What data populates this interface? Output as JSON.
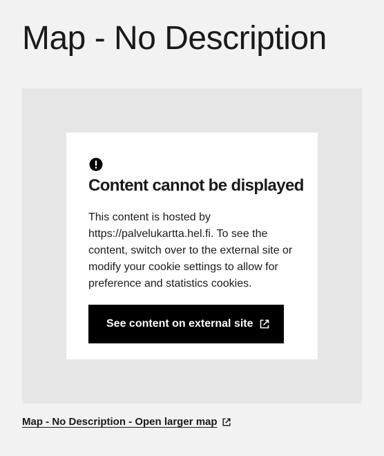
{
  "page": {
    "title": "Map - No Description"
  },
  "notice": {
    "icon": "alert-circle-icon",
    "heading": "Content cannot be displayed",
    "body": "This content is hosted by https://palvelukartta.hel.fi. To see the content, switch over to the external site or modify your cookie settings to allow for preference and statistics cookies.",
    "button_label": "See content on external site",
    "button_icon": "external-link-icon"
  },
  "footer_link": {
    "label": "Map - No Description - Open larger map",
    "icon": "external-link-icon"
  },
  "colors": {
    "page_background": "#f2f2f2",
    "map_placeholder": "#e6e6e6",
    "card_background": "#ffffff",
    "button_background": "#000000",
    "button_text": "#ffffff",
    "text": "#1a1a1a"
  }
}
